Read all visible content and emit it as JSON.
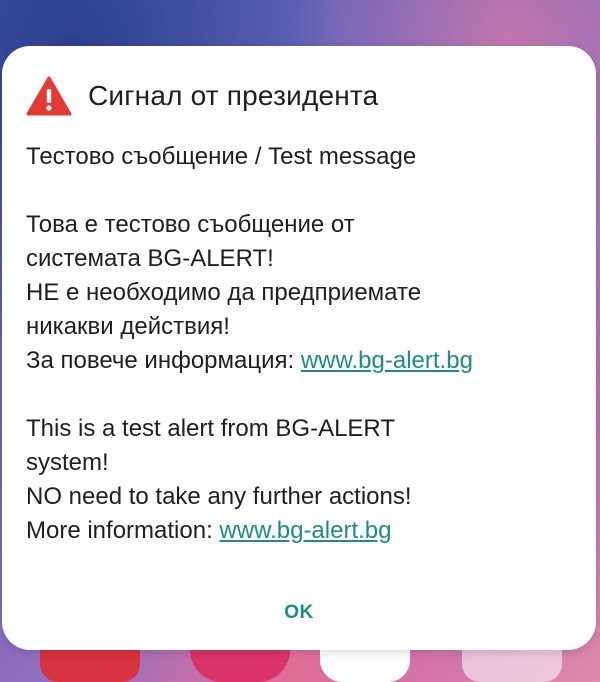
{
  "dialog": {
    "title": "Сигнал от президента",
    "icon": "warning-icon",
    "subject": "Тестово съобщение / Test message",
    "bg_lines": [
      "Това е тестово съобщение от",
      "системата BG-ALERT!",
      "НЕ е необходимо да предприемате",
      "никакви действия!"
    ],
    "bg_more_label": "За повече информация: ",
    "bg_more_link": "www.bg-alert.bg",
    "en_lines": [
      "This is a test alert from BG-ALERT",
      "system!",
      "NO need to take any further actions!"
    ],
    "en_more_label": "More information: ",
    "en_more_link": "www.bg-alert.bg",
    "ok_label": "OK"
  },
  "colors": {
    "accent": "#1e8c86",
    "warning": "#e53935",
    "text": "#1f1f1f",
    "dialog_bg": "#ffffff"
  },
  "dock": {
    "icons": [
      "phone-icon",
      "flower-icon",
      "play-store-icon",
      "apps-folder-icon"
    ]
  }
}
